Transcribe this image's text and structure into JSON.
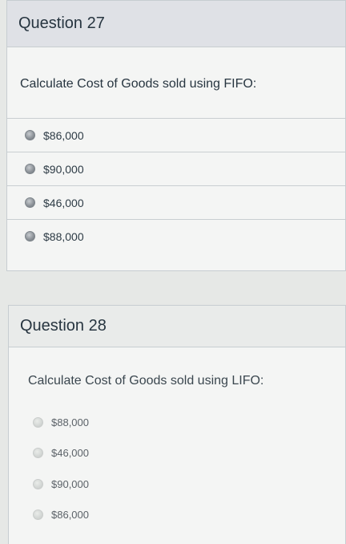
{
  "questions": [
    {
      "title": "Question 27",
      "prompt": "Calculate Cost of Goods sold using FIFO:",
      "options": [
        "$86,000",
        "$90,000",
        "$46,000",
        "$88,000"
      ]
    },
    {
      "title": "Question 28",
      "prompt": "Calculate Cost of Goods sold using LIFO:",
      "options": [
        "$88,000",
        "$46,000",
        "$90,000",
        "$86,000"
      ]
    }
  ],
  "icons": {
    "radio": "radio-button-icon"
  }
}
